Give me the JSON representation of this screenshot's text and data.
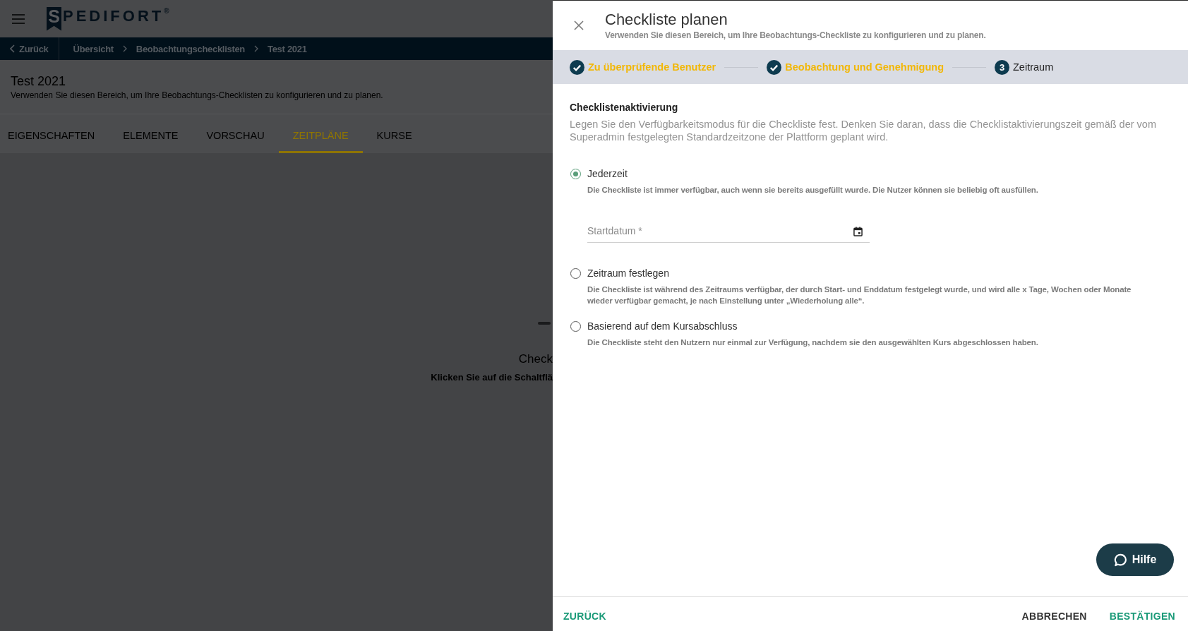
{
  "header": {
    "logo": {
      "initial": "S",
      "text": "PEDIFORT",
      "mark": "®"
    }
  },
  "breadcrumbs": {
    "back": "Zurück",
    "items": [
      "Übersicht",
      "Beobachtungschecklisten",
      "Test 2021"
    ]
  },
  "page": {
    "title": "Test 2021",
    "subtitle": "Verwenden Sie diesen Bereich, um Ihre Beobachtungs-Checklisten zu konfigurieren und zu planen."
  },
  "tabs": [
    {
      "label": "EIGENSCHAFTEN",
      "selected": false
    },
    {
      "label": "ELEMENTE",
      "selected": false
    },
    {
      "label": "VORSCHAU",
      "selected": false
    },
    {
      "label": "ZEITPLÄNE",
      "selected": true
    },
    {
      "label": "KURSE",
      "selected": false
    }
  ],
  "empty_state": {
    "title": "Check",
    "hint": "Klicken Sie auf die Schaltflä"
  },
  "panel": {
    "title": "Checkliste planen",
    "subtitle": "Verwenden Sie diesen Bereich, um Ihre Beobachtungs-Checkliste zu konfigurieren und zu planen.",
    "steps": [
      {
        "label": "Zu überprüfende Benutzer",
        "completed": true
      },
      {
        "label": "Beobachtung und Genehmigung",
        "completed": true
      },
      {
        "label": "Zeitraum",
        "completed": false,
        "number": "3"
      }
    ],
    "section": {
      "heading": "Checklistenaktivierung",
      "description": "Legen Sie den Verfügbarkeitsmodus für die Checkliste fest. Denken Sie daran, dass die Checklistaktivierungszeit gemäß der vom Superadmin festgelegten Standardzeitzone der Plattform geplant wird."
    },
    "options": [
      {
        "label": "Jederzeit",
        "description": "Die Checkliste ist immer verfügbar, auch wenn sie bereits ausgefüllt wurde. Die Nutzer können sie beliebig oft ausfüllen.",
        "selected": true,
        "date_field": {
          "placeholder": "Startdatum *"
        }
      },
      {
        "label": "Zeitraum festlegen",
        "description": "Die Checkliste ist während des Zeitraums verfügbar, der durch Start- und Enddatum festgelegt wurde, und wird alle x Tage, Wochen oder Monate wieder verfügbar gemacht, je nach Einstellung unter „Wiederholung alle“.",
        "selected": false
      },
      {
        "label": "Basierend auf dem Kursabschluss",
        "description": "Die Checkliste steht den Nutzern nur einmal zur Verfügung, nachdem sie den ausgewählten Kurs abgeschlossen haben.",
        "selected": false
      }
    ],
    "help_button": "Hilfe",
    "footer": {
      "back": "ZURÜCK",
      "cancel": "ABBRECHEN",
      "confirm": "BESTÄTIGEN"
    }
  }
}
